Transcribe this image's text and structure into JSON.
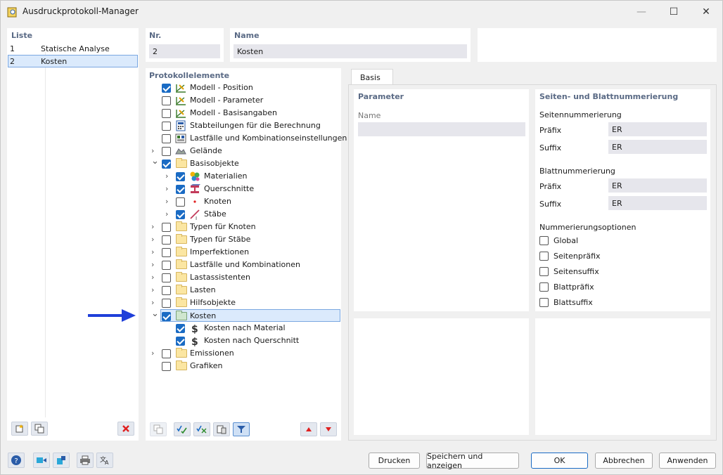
{
  "window": {
    "title": "Ausdruckprotokoll-Manager",
    "minimize": "—",
    "maximize": "☐",
    "close": "✕"
  },
  "list": {
    "header": "Liste",
    "rows": [
      {
        "nr": "1",
        "name": "Statische Analyse",
        "selected": false
      },
      {
        "nr": "2",
        "name": "Kosten",
        "selected": true
      }
    ]
  },
  "header_fields": {
    "nr_label": "Nr.",
    "nr_value": "2",
    "name_label": "Name",
    "name_value": "Kosten"
  },
  "tree": {
    "header": "Protokollelemente",
    "items": [
      {
        "label": "Modell - Position",
        "checked": true,
        "expand": "",
        "icon": "model-icon",
        "level": 0
      },
      {
        "label": "Modell - Parameter",
        "checked": false,
        "expand": "",
        "icon": "model-icon",
        "level": 0
      },
      {
        "label": "Modell - Basisangaben",
        "checked": false,
        "expand": "",
        "icon": "model-icon",
        "level": 0
      },
      {
        "label": "Stabteilungen für die Berechnung",
        "checked": false,
        "expand": "",
        "icon": "calc-icon",
        "level": 0
      },
      {
        "label": "Lastfälle und Kombinationseinstellungen",
        "checked": false,
        "expand": "",
        "icon": "loadcase-icon",
        "level": 0
      },
      {
        "label": "Gelände",
        "checked": false,
        "expand": "›",
        "icon": "terrain-icon",
        "level": 0
      },
      {
        "label": "Basisobjekte",
        "checked": true,
        "expand": "⌄",
        "icon": "folder-icon",
        "level": 0
      },
      {
        "label": "Materialien",
        "checked": true,
        "expand": "›",
        "icon": "materials-icon",
        "level": 1
      },
      {
        "label": "Querschnitte",
        "checked": true,
        "expand": "›",
        "icon": "section-icon",
        "level": 1
      },
      {
        "label": "Knoten",
        "checked": false,
        "expand": "›",
        "icon": "node-icon",
        "level": 1
      },
      {
        "label": "Stäbe",
        "checked": true,
        "expand": "›",
        "icon": "member-icon",
        "level": 1
      },
      {
        "label": "Typen für Knoten",
        "checked": false,
        "expand": "›",
        "icon": "folder-icon",
        "level": 0
      },
      {
        "label": "Typen für Stäbe",
        "checked": false,
        "expand": "›",
        "icon": "folder-icon",
        "level": 0
      },
      {
        "label": "Imperfektionen",
        "checked": false,
        "expand": "›",
        "icon": "folder-icon",
        "level": 0
      },
      {
        "label": "Lastfälle und Kombinationen",
        "checked": false,
        "expand": "›",
        "icon": "folder-icon",
        "level": 0
      },
      {
        "label": "Lastassistenten",
        "checked": false,
        "expand": "›",
        "icon": "folder-icon",
        "level": 0
      },
      {
        "label": "Lasten",
        "checked": false,
        "expand": "›",
        "icon": "folder-icon",
        "level": 0
      },
      {
        "label": "Hilfsobjekte",
        "checked": false,
        "expand": "›",
        "icon": "folder-icon",
        "level": 0
      },
      {
        "label": "Kosten",
        "checked": true,
        "expand": "⌄",
        "icon": "folder-green-icon",
        "level": 0,
        "selected": true
      },
      {
        "label": "Kosten nach Material",
        "checked": true,
        "expand": "",
        "icon": "dollar-icon",
        "level": 1
      },
      {
        "label": "Kosten nach Querschnitt",
        "checked": true,
        "expand": "",
        "icon": "dollar-icon",
        "level": 1
      },
      {
        "label": "Emissionen",
        "checked": false,
        "expand": "›",
        "icon": "folder-icon",
        "level": 0
      },
      {
        "label": "Grafiken",
        "checked": false,
        "expand": "",
        "icon": "folder-icon",
        "level": 0
      }
    ]
  },
  "tabs": [
    {
      "label": "Basis"
    }
  ],
  "parameter": {
    "header": "Parameter",
    "name_label": "Name",
    "name_value": ""
  },
  "numbering": {
    "header": "Seiten- und Blattnummerierung",
    "page_header": "Seitennummerierung",
    "page_prefix_label": "Präfix",
    "page_prefix_value": "ER",
    "page_suffix_label": "Suffix",
    "page_suffix_value": "ER",
    "sheet_header": "Blattnummerierung",
    "sheet_prefix_label": "Präfix",
    "sheet_prefix_value": "ER",
    "sheet_suffix_label": "Suffix",
    "sheet_suffix_value": "ER",
    "options_header": "Nummerierungsoptionen",
    "options": [
      {
        "label": "Global",
        "checked": false
      },
      {
        "label": "Seitenpräfix",
        "checked": false
      },
      {
        "label": "Seitensuffix",
        "checked": false
      },
      {
        "label": "Blattpräfix",
        "checked": false
      },
      {
        "label": "Blattsuffix",
        "checked": false
      }
    ]
  },
  "buttons": {
    "print": "Drucken",
    "save_show": "Speichern und anzeigen",
    "ok": "OK",
    "cancel": "Abbrechen",
    "apply": "Anwenden"
  },
  "colors": {
    "accent": "#1a6bc4",
    "selection": "#dbeafc",
    "header_text": "#5a6a85",
    "arrow": "#1f3fd9",
    "delete": "#e02020"
  }
}
